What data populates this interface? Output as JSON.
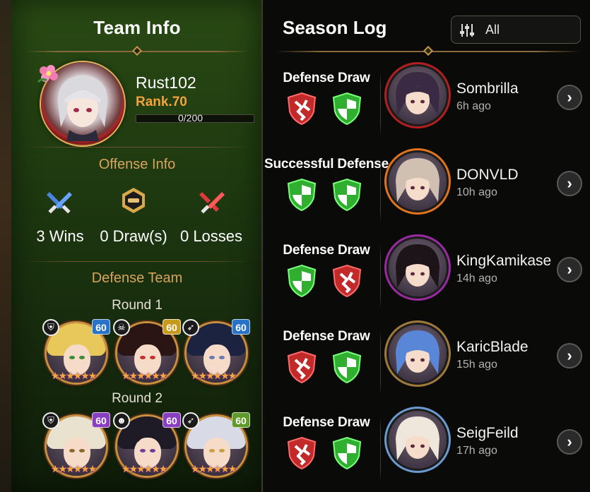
{
  "team_info": {
    "title": "Team Info",
    "player": {
      "name": "Rust102",
      "rank": "Rank.70",
      "exp": "0/200",
      "exp_progress": 0
    },
    "offense": {
      "label": "Offense Info",
      "wins": "3 Wins",
      "draws": "0 Draw(s)",
      "losses": "0 Losses"
    },
    "defense": {
      "label": "Defense Team",
      "rounds": [
        {
          "label": "Round 1",
          "heroes": [
            {
              "level": "60",
              "badge": "lv-blue",
              "hair": "#e8c85a",
              "eye": "#3c8a3a",
              "stars": 6,
              "class_icon": "shield-icon"
            },
            {
              "level": "60",
              "badge": "lv-gold",
              "hair": "#2a1414",
              "eye": "#c23030",
              "stars": 6,
              "class_icon": "skull-icon"
            },
            {
              "level": "60",
              "badge": "lv-blue",
              "hair": "#1b2340",
              "eye": "#6a7ab0",
              "stars": 6,
              "class_icon": "bow-icon"
            }
          ]
        },
        {
          "label": "Round 2",
          "heroes": [
            {
              "level": "60",
              "badge": "lv-purple",
              "hair": "#e9e2cf",
              "eye": "#8a6a2a",
              "stars": 6,
              "class_icon": "shield-icon"
            },
            {
              "level": "60",
              "badge": "lv-purple",
              "hair": "#1e1a26",
              "eye": "#7a3a9a",
              "stars": 6,
              "class_icon": "thief-icon"
            },
            {
              "level": "60",
              "badge": "lv-green",
              "hair": "#d8dae6",
              "eye": "#c9a040",
              "stars": 6,
              "class_icon": "bow-icon"
            }
          ]
        }
      ]
    }
  },
  "season_log": {
    "title": "Season Log",
    "filter": {
      "label": "All",
      "icon": "filter-sliders-icon"
    },
    "entries": [
      {
        "result": "Defense Draw",
        "shields": [
          "red",
          "green"
        ],
        "name": "Sombrilla",
        "time": "6h ago",
        "hair": "#3a2a44",
        "frame": "#b02020"
      },
      {
        "result": "Successful Defense",
        "shields": [
          "green",
          "green"
        ],
        "name": "DONVLD",
        "time": "10h ago",
        "hair": "#cfc0b2",
        "frame": "#e0731c"
      },
      {
        "result": "Defense Draw",
        "shields": [
          "green",
          "red"
        ],
        "name": "KingKamikase",
        "time": "14h ago",
        "hair": "#1c1418",
        "frame": "#9a2aa0"
      },
      {
        "result": "Defense Draw",
        "shields": [
          "red",
          "green"
        ],
        "name": "KaricBlade",
        "time": "15h ago",
        "hair": "#5a86d8",
        "frame": "#a07a3a"
      },
      {
        "result": "Defense Draw",
        "shields": [
          "red",
          "green"
        ],
        "name": "SeigFeild",
        "time": "17h ago",
        "hair": "#efe6dc",
        "frame": "#6a9ad0"
      }
    ]
  },
  "colors": {
    "accent_gold": "#d7a45c",
    "rank_orange": "#f6a23a",
    "shield_green": "#2fae2f",
    "shield_red": "#c22a2a"
  }
}
